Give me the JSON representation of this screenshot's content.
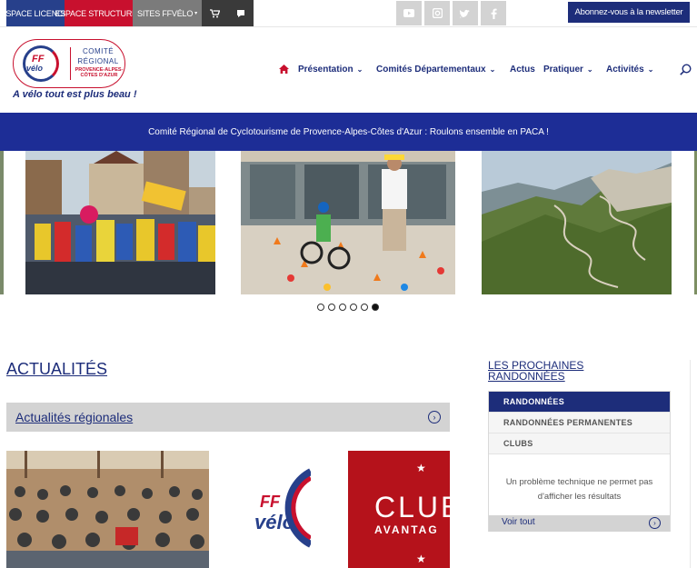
{
  "topbar": {
    "espace_licencie": "ESPACE LICENCIE",
    "espace_structures": "ESPACE STRUCTURES",
    "sites_ffvelo": "SITES FFVÉLO",
    "newsletter": "Abonnez-vous à la newsletter"
  },
  "logo": {
    "ff": "FF",
    "velo": "vélo",
    "comite": "COMITÉ",
    "regional": "RÉGIONAL",
    "region": "PROVENCE-ALPES-CÔTES D'AZUR",
    "tagline": "A vélo tout est plus beau !"
  },
  "nav": {
    "presentation": "Présentation",
    "comites": "Comités Départementaux",
    "actus": "Actus",
    "pratiquer": "Pratiquer",
    "activites": "Activités"
  },
  "banner": {
    "text": "Comité Régional de Cyclotourisme de Provence-Alpes-Côtes d'Azur : Roulons ensemble en PACA !"
  },
  "slider": {
    "dot_count": 6,
    "active_index": 5
  },
  "actualites": {
    "title": "ACTUALITÉS",
    "bar_label": "Actualités régionales",
    "club_text": "CLUB",
    "club_sub": "AVANTAG",
    "club_logo_ff": "FF",
    "club_logo_velo": "vélo"
  },
  "sidebar": {
    "title": "LES PROCHAINES RANDONNÉES",
    "tabs": [
      "RANDONNÉES",
      "RANDONNÉES PERMANENTES",
      "CLUBS"
    ],
    "message": "Un problème technique ne permet pas d'afficher les résultats",
    "voir_tout": "Voir tout"
  },
  "colors": {
    "navy": "#1d2d7a",
    "red": "#c8102e",
    "banner": "#1d2d96",
    "gray": "#d3d3d3"
  }
}
